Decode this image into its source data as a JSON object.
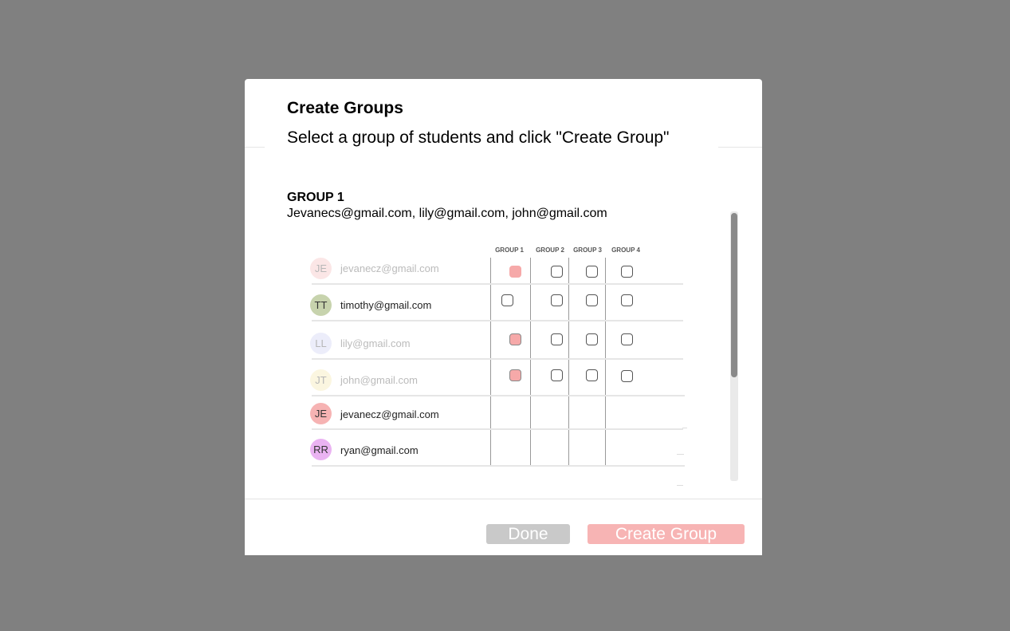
{
  "modal": {
    "title": "Create Groups",
    "subtitle": "Select a group of students and click \"Create Group\"",
    "group": {
      "heading": "GROUP 1",
      "members": "Jevanecs@gmail.com, lily@gmail.com, john@gmail.com"
    },
    "columns": [
      "GROUP 1",
      "GROUP 2",
      "GROUP 3",
      "GROUP 4"
    ],
    "students": [
      {
        "initials": "JE",
        "email": "jevanecz@gmail.com",
        "color": "#f6b8b8",
        "faded": true,
        "checks": [
          true,
          false,
          false,
          false
        ]
      },
      {
        "initials": "TT",
        "email": "timothy@gmail.com",
        "color": "#c7d3ad",
        "faded": false,
        "checks": [
          false,
          false,
          false,
          false
        ]
      },
      {
        "initials": "LL",
        "email": "lily@gmail.com",
        "color": "#c9cdf3",
        "faded": true,
        "checks": [
          true,
          false,
          false,
          false
        ]
      },
      {
        "initials": "JT",
        "email": "john@gmail.com",
        "color": "#f5e7a8",
        "faded": true,
        "checks": [
          true,
          false,
          false,
          false
        ]
      },
      {
        "initials": "JE",
        "email": "jevanecz@gmail.com",
        "color": "#f6b3b3",
        "faded": false,
        "checks": null
      },
      {
        "initials": "RR",
        "email": "ryan@gmail.com",
        "color": "#eab3f2",
        "faded": false,
        "checks": null
      }
    ],
    "buttons": {
      "done": "Done",
      "create": "Create Group"
    }
  }
}
